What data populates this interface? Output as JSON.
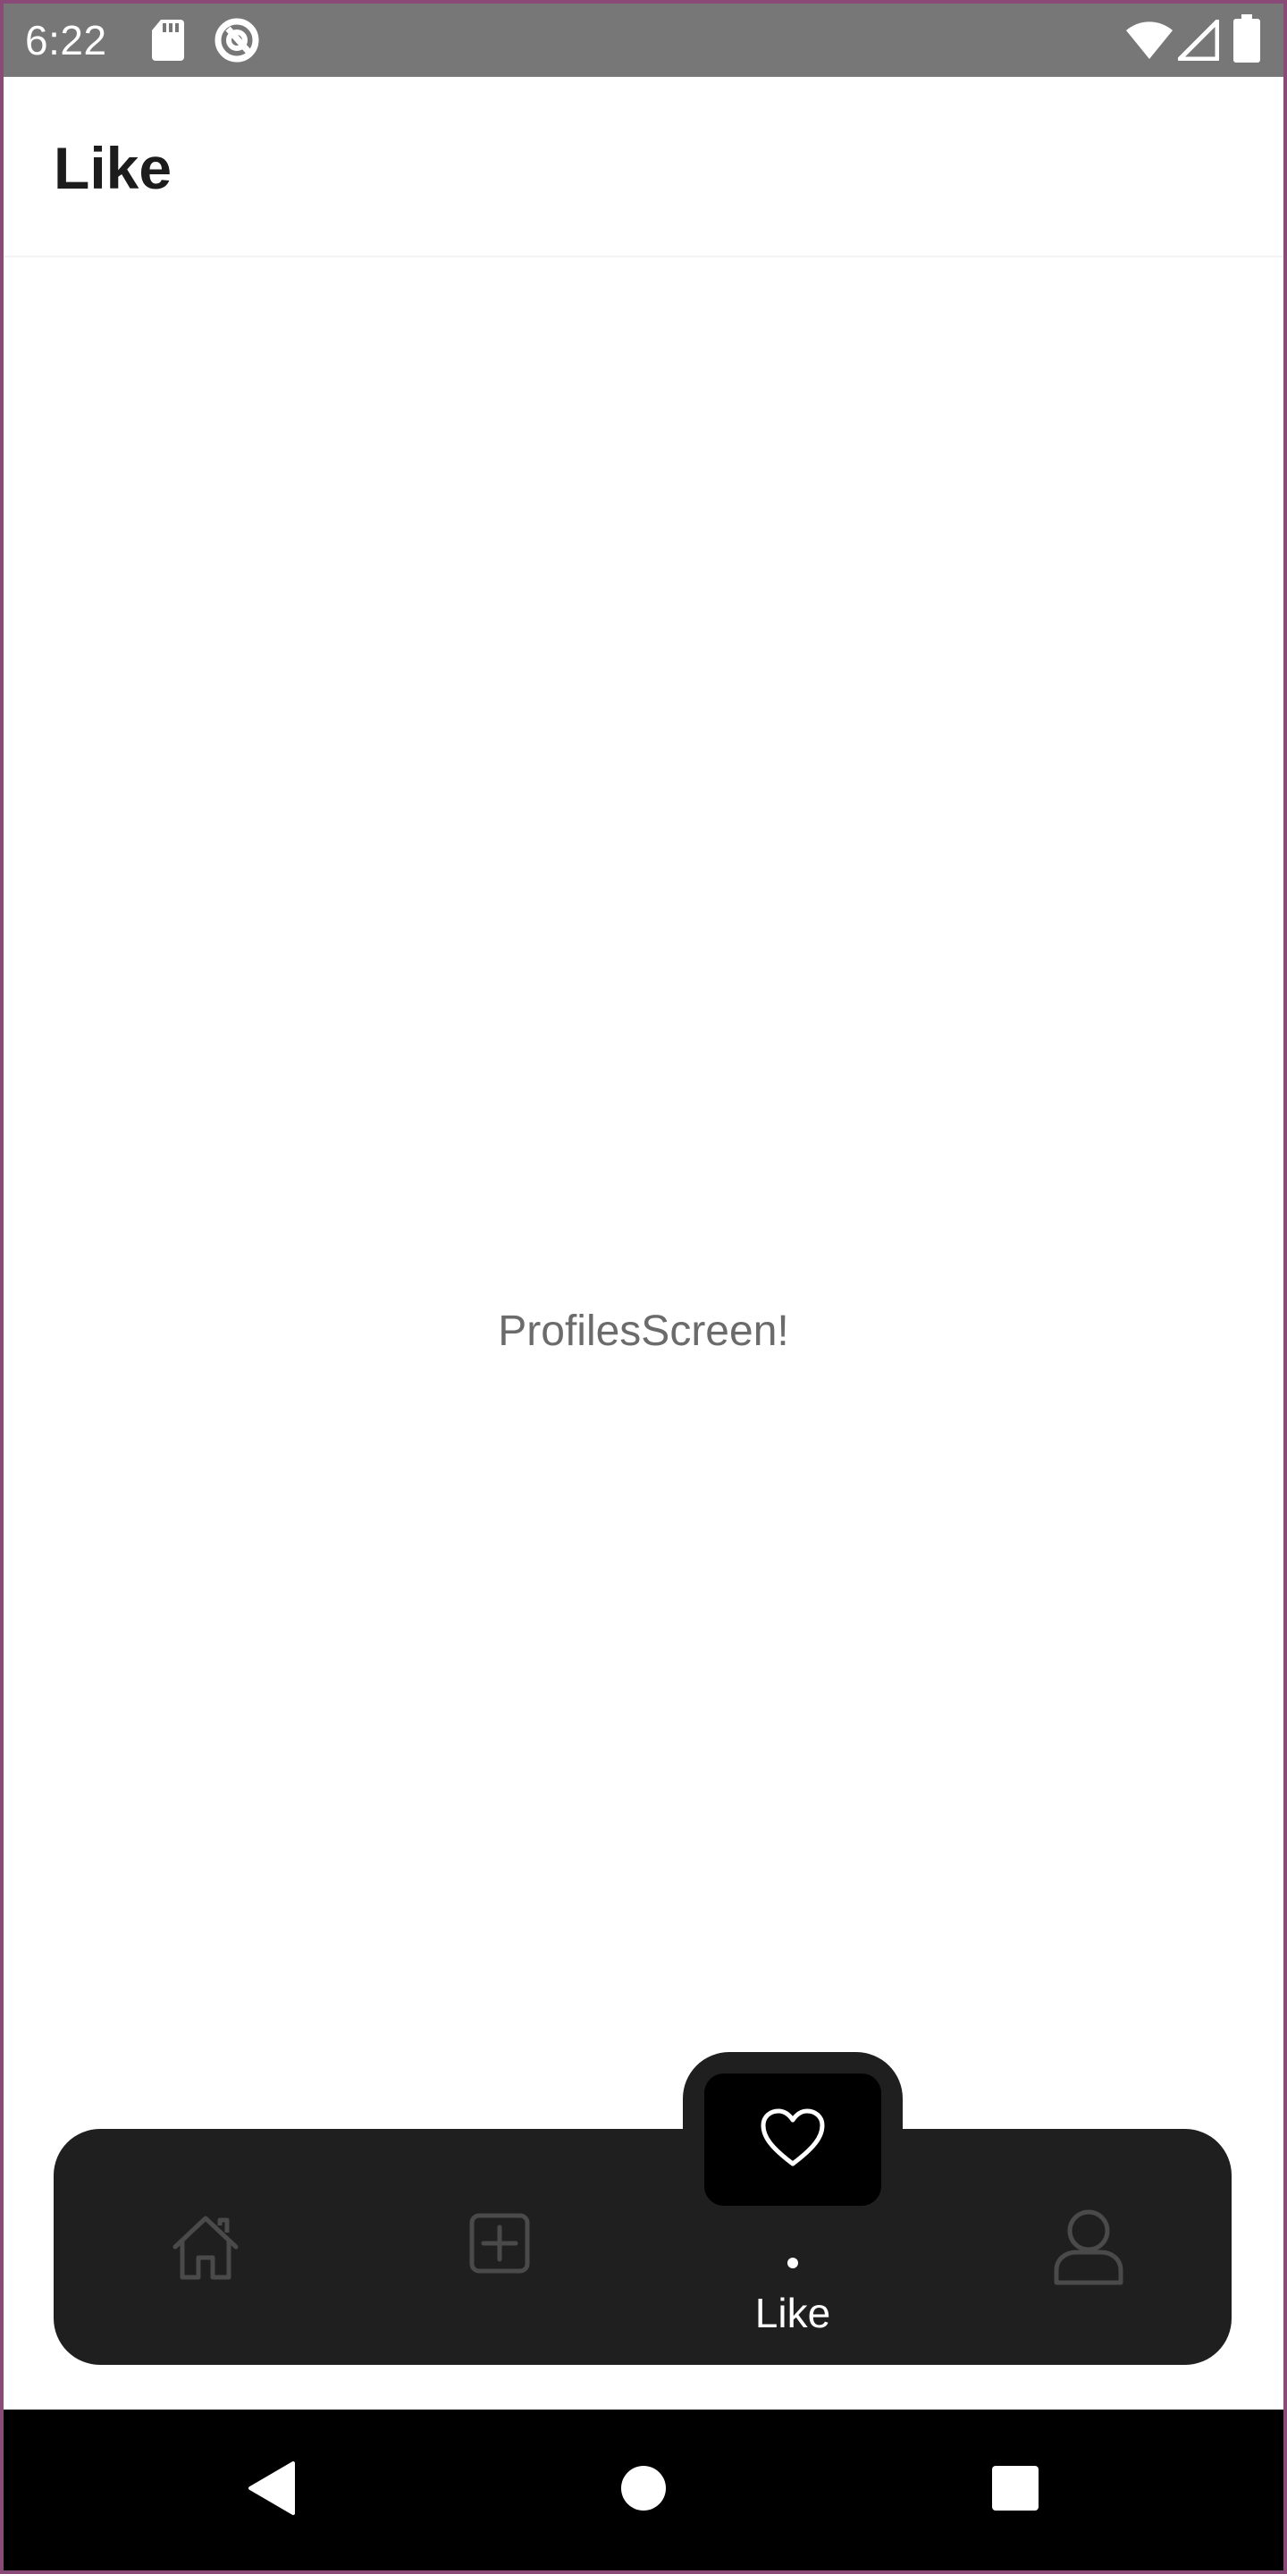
{
  "status_bar": {
    "time": "6:22",
    "left_icons": [
      "sd-card-icon",
      "data-saver-icon"
    ],
    "right_icons": [
      "wifi-icon",
      "signal-icon",
      "battery-icon"
    ],
    "background": "#777777"
  },
  "header": {
    "title": "Like"
  },
  "content": {
    "text": "ProfilesScreen!"
  },
  "tab_bar": {
    "background": "#1f1f1f",
    "items": [
      {
        "icon": "home-icon",
        "label": "",
        "active": false
      },
      {
        "icon": "add-square-icon",
        "label": "",
        "active": false
      },
      {
        "icon": "heart-icon",
        "label": "Like",
        "active": true
      },
      {
        "icon": "profile-icon",
        "label": "",
        "active": false
      }
    ]
  },
  "nav_bar": {
    "buttons": [
      "back-icon",
      "home-circle-icon",
      "recents-icon"
    ]
  }
}
